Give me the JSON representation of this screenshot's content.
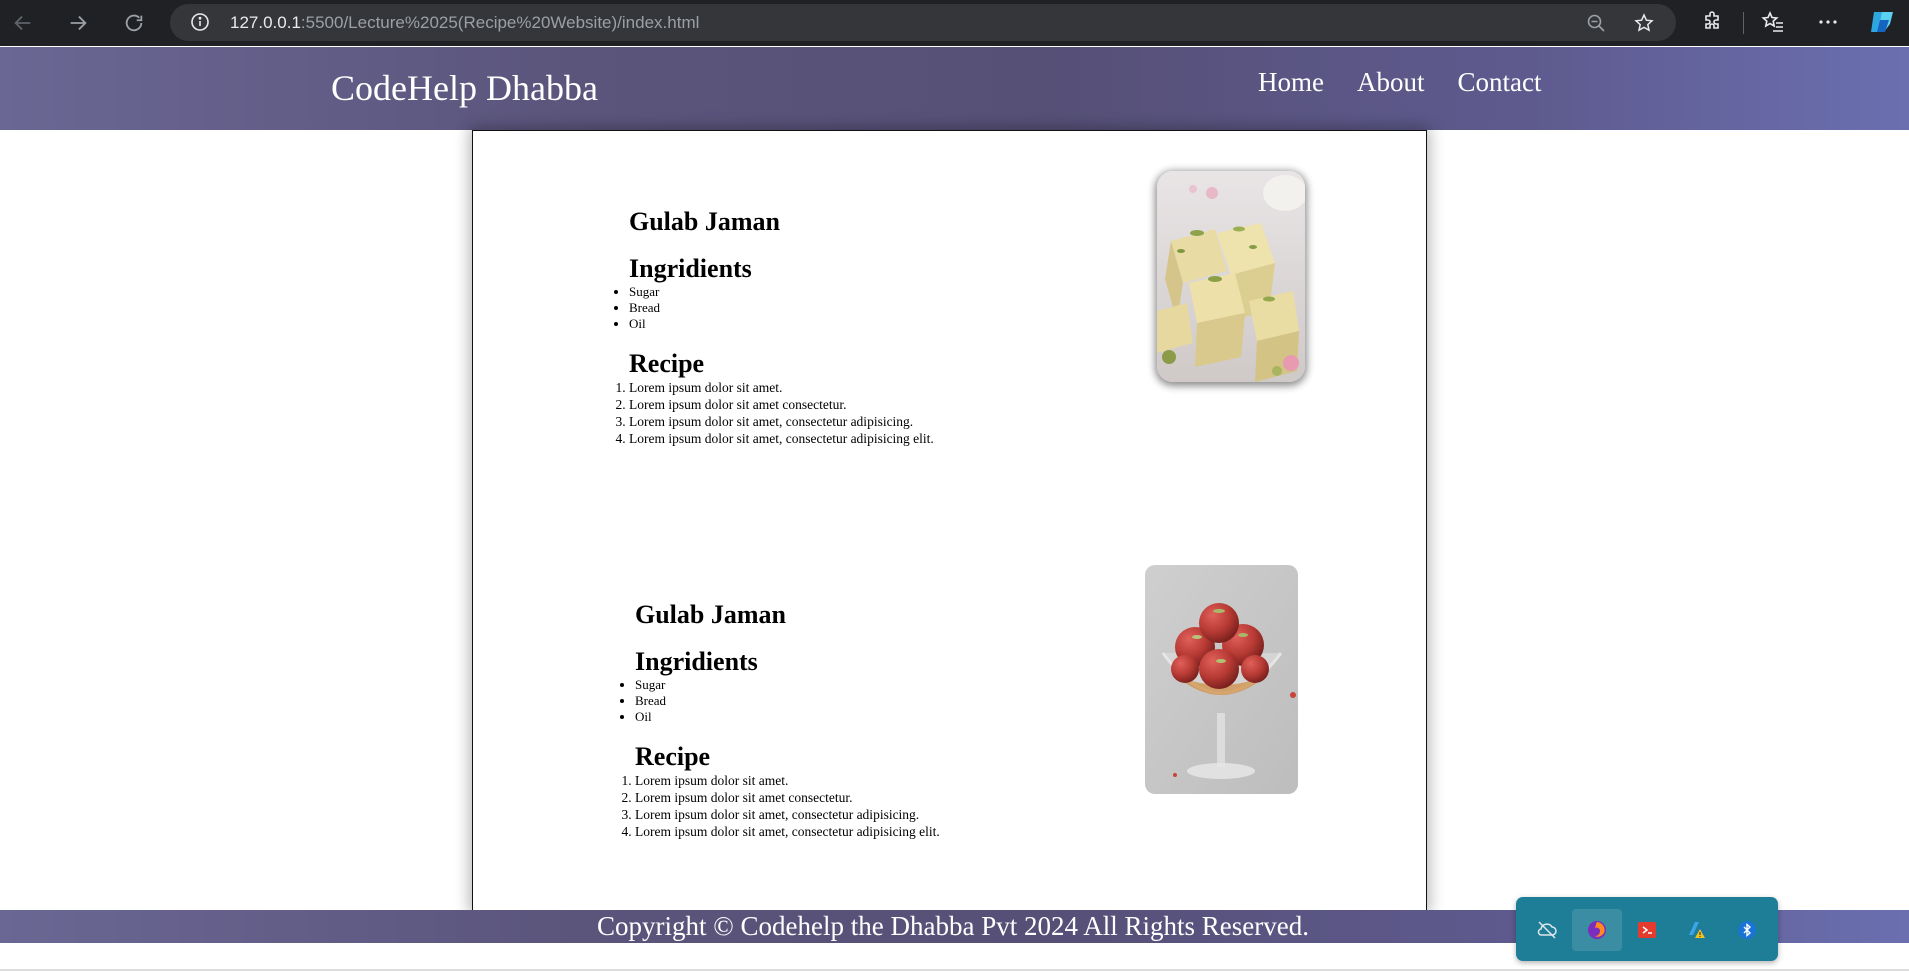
{
  "browser": {
    "url_host": "127.0.0.1",
    "url_rest": ":5500/Lecture%2025(Recipe%20Website)/index.html",
    "icons": [
      "back-icon",
      "forward-icon",
      "reload-icon",
      "site-info-icon",
      "zoom-icon",
      "favorite-star-icon",
      "extensions-icon",
      "favorites-icon",
      "more-icon",
      "copilot-icon"
    ]
  },
  "site": {
    "brand": "CodeHelp Dhabba",
    "nav": [
      "Home",
      "About",
      "Contact"
    ]
  },
  "recipes": [
    {
      "name": "Gulab Jaman",
      "ingredients_title": "Ingridients",
      "ingredients": [
        "Sugar",
        "Bread",
        "Oil"
      ],
      "recipe_title": "Recipe",
      "steps": [
        "Lorem ipsum dolor sit amet.",
        "Lorem ipsum dolor sit amet consectetur.",
        "Lorem ipsum dolor sit amet, consectetur adipisicing.",
        "Lorem ipsum dolor sit amet, consectetur adipisicing elit."
      ],
      "image": "barfi-sweets-photo"
    },
    {
      "name": "Gulab Jaman",
      "ingredients_title": "Ingridients",
      "ingredients": [
        "Sugar",
        "Bread",
        "Oil"
      ],
      "recipe_title": "Recipe",
      "steps": [
        "Lorem ipsum dolor sit amet.",
        "Lorem ipsum dolor sit amet consectetur.",
        "Lorem ipsum dolor sit amet, consectetur adipisicing.",
        "Lorem ipsum dolor sit amet, consectetur adipisicing elit."
      ],
      "image": "gulab-jamun-glass-photo"
    }
  ],
  "footer": {
    "text": "Copyright © Codehelp the Dhabba Pvt 2024 All Rights Reserved."
  },
  "tray": {
    "icons": [
      "cloud-off-icon",
      "firefox-icon",
      "remote-desktop-icon",
      "azure-warning-icon",
      "bluetooth-icon"
    ]
  },
  "colors": {
    "header_gradient": "#5b557c",
    "chrome_bg": "#202124",
    "tray_bg": "#1e7d97"
  }
}
